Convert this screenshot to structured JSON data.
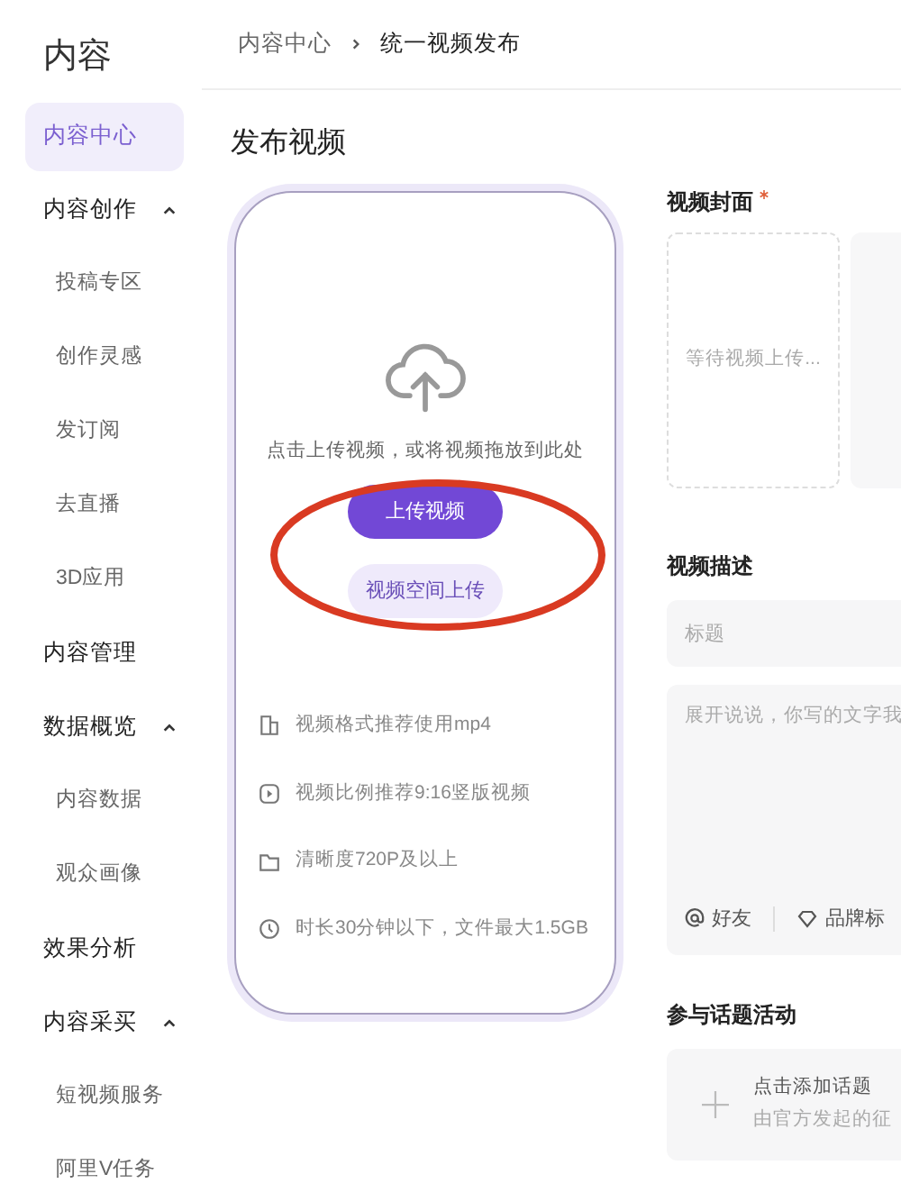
{
  "sidebar": {
    "title": "内容",
    "items": [
      {
        "label": "内容中心",
        "selected": true
      },
      {
        "label": "内容创作",
        "selected": false,
        "expanded": true,
        "children": [
          {
            "label": "投稿专区",
            "selected": false
          },
          {
            "label": "创作灵感",
            "selected": false
          },
          {
            "label": "发订阅",
            "selected": false
          },
          {
            "label": "去直播",
            "selected": false
          },
          {
            "label": "3D应用",
            "selected": false
          }
        ]
      },
      {
        "label": "内容管理",
        "selected": false
      },
      {
        "label": "数据概览",
        "selected": false,
        "expanded": true,
        "children": [
          {
            "label": "内容数据",
            "selected": false
          },
          {
            "label": "观众画像",
            "selected": false
          }
        ]
      },
      {
        "label": "效果分析",
        "selected": false
      },
      {
        "label": "内容采买",
        "selected": false,
        "expanded": true,
        "children": [
          {
            "label": "短视频服务",
            "selected": false
          },
          {
            "label": "阿里V任务",
            "selected": false
          }
        ]
      }
    ]
  },
  "breadcrumb": [
    "内容中心",
    "统一视频发布"
  ],
  "page_title": "发布视频",
  "upload": {
    "hint": "点击上传视频，或将视频拖放到此处",
    "primary_button": "上传视频",
    "secondary_button": "视频空间上传",
    "annotated": true,
    "requirements": [
      {
        "kind": "format",
        "text": "视频格式推荐使用mp4"
      },
      {
        "kind": "ratio",
        "text": "视频比例推荐9:16竖版视频"
      },
      {
        "kind": "resolution",
        "text": "清晰度720P及以上"
      },
      {
        "kind": "duration",
        "text": "时长30分钟以下，文件最大1.5GB"
      }
    ]
  },
  "cover": {
    "label": "视频封面",
    "required": true,
    "placeholder": "等待视频上传..."
  },
  "description": {
    "label": "视频描述",
    "title_placeholder": "标题",
    "body_placeholder": "展开说说，你写的文字我",
    "tools": [
      {
        "kind": "mention",
        "label": "好友"
      },
      {
        "kind": "brand",
        "label": "品牌标"
      }
    ]
  },
  "topic": {
    "label": "参与话题活动",
    "action": "点击添加话题",
    "subtitle": "由官方发起的征"
  }
}
